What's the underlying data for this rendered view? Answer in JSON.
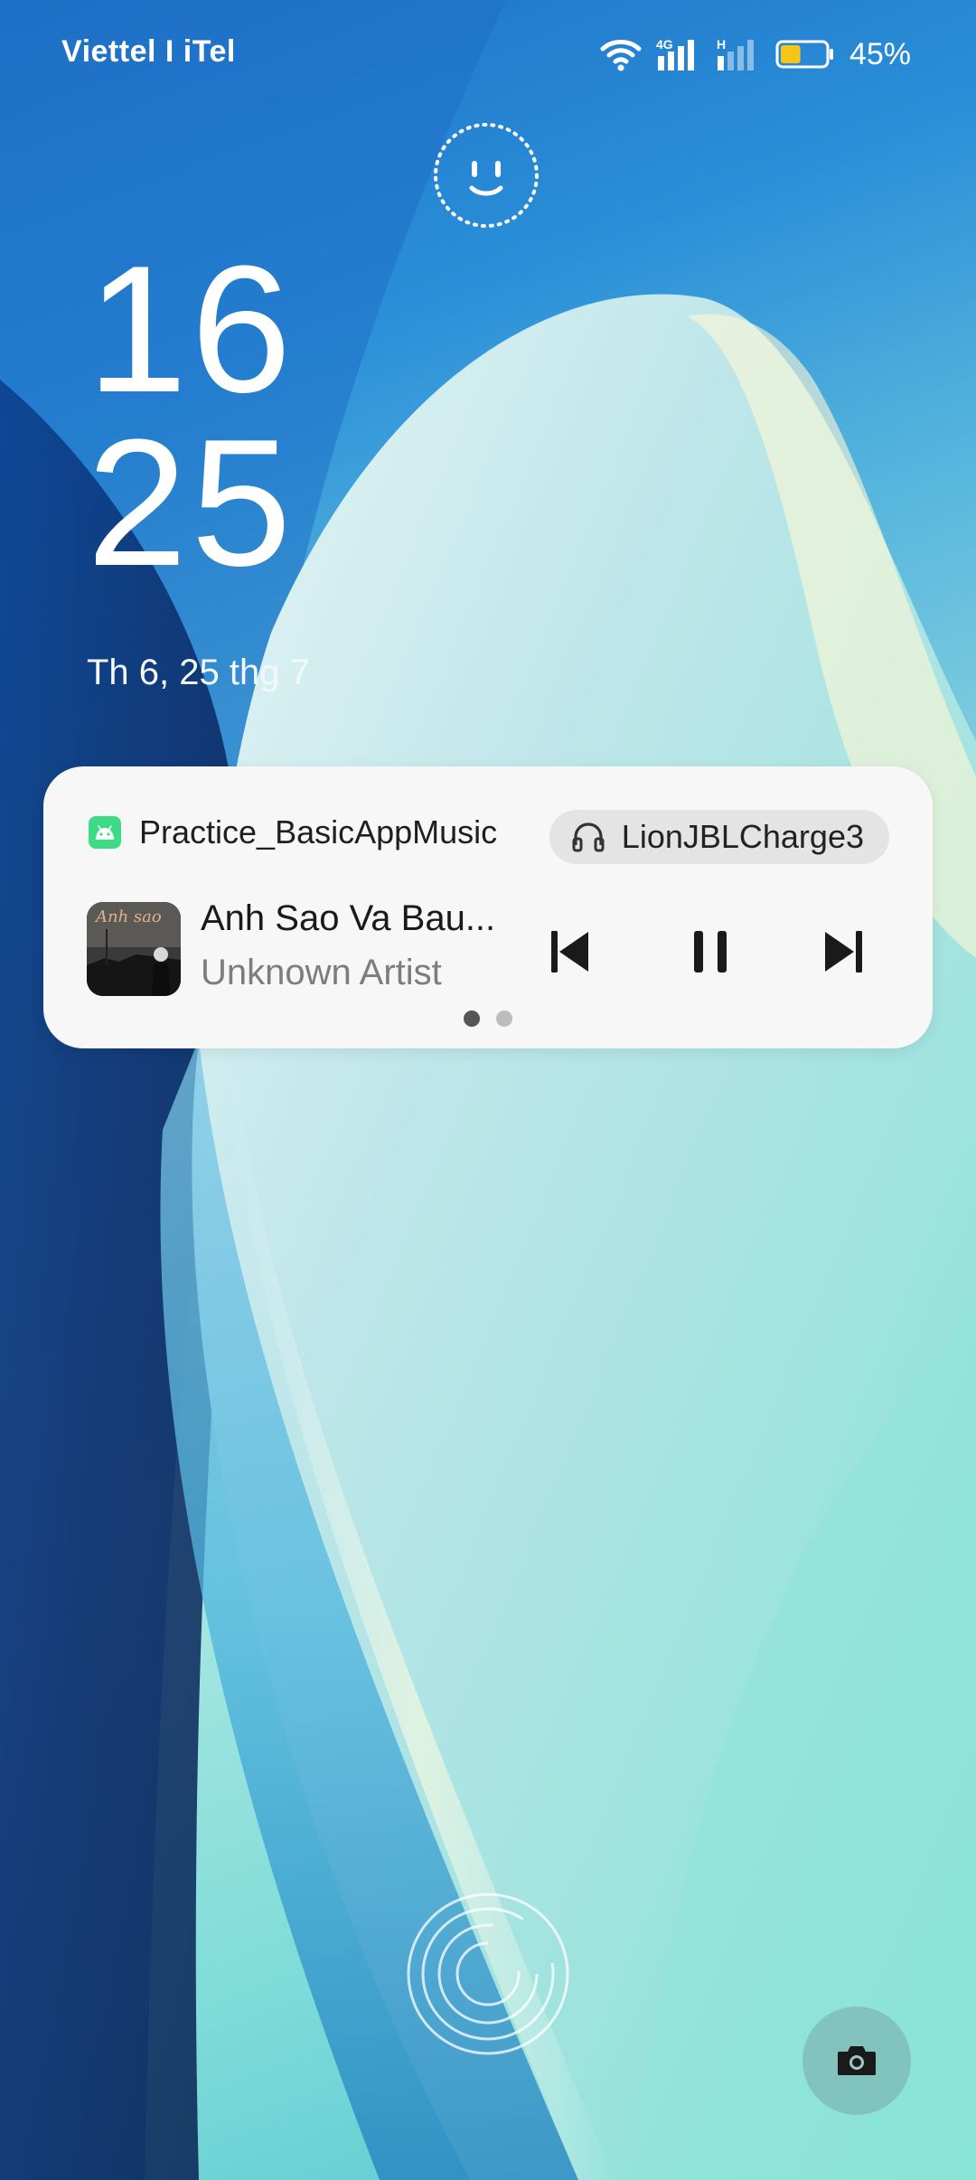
{
  "status_bar": {
    "carrier": "Viettel I iTel",
    "network_type": "4G",
    "secondary_network_type": "H",
    "battery_percent": "45%",
    "battery_level": 0.45,
    "battery_color": "#f5c518"
  },
  "lock_screen": {
    "clock_hour": "16",
    "clock_minute": "25",
    "date": "Th 6, 25 thg 7"
  },
  "media_player": {
    "app_name": "Practice_BasicAppMusic",
    "output_device": "LionJBLCharge3",
    "song_title": "Anh Sao Va Bau...",
    "artist": "Unknown Artist",
    "album_art_text": "Anh sao",
    "page_count": 2,
    "active_page": 1
  },
  "icons": {
    "face_unlock": "face-unlock-icon",
    "fingerprint": "fingerprint-icon",
    "camera": "camera-icon",
    "wifi": "wifi-icon",
    "headphones": "headphones-icon",
    "previous": "skip-previous-icon",
    "pause": "pause-icon",
    "next": "skip-next-icon"
  },
  "colors": {
    "card_background": "#f7f7f7",
    "device_chip_background": "#e4e4e4",
    "android_app_icon": "#3ddc84",
    "text_primary": "#1a1a1a",
    "text_secondary": "#7d7d7d"
  }
}
